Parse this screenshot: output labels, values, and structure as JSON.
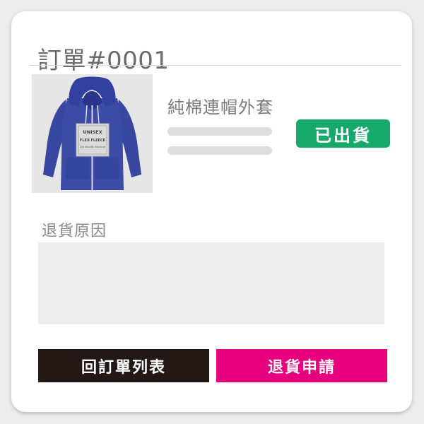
{
  "order": {
    "title": "訂單#0001"
  },
  "product": {
    "name": "純棉連帽外套",
    "status": "已出貨",
    "image": {
      "icon": "hoodie-image",
      "label_lines": [
        "UNISEX",
        "FLEX FLEECE",
        "Zip Hoodie Mockup"
      ]
    }
  },
  "return_form": {
    "reason_label": "退貨原因",
    "reason_value": "",
    "reason_placeholder": ""
  },
  "actions": {
    "back_label": "回訂單列表",
    "submit_label": "退貨申請"
  },
  "colors": {
    "status_badge": "#17a86b",
    "back_button": "#231815",
    "submit_button": "#e6007e",
    "hoodie": "#3a4a9e"
  }
}
